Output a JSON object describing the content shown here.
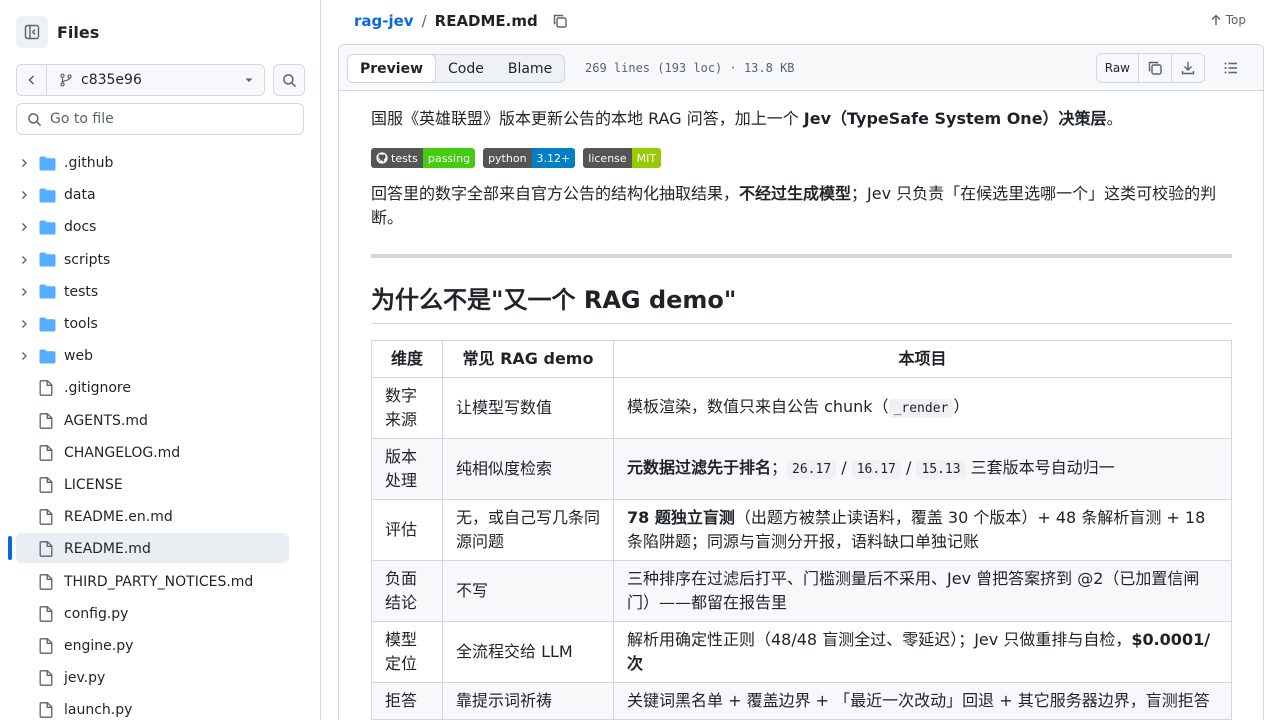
{
  "sidebar": {
    "title": "Files",
    "branch": "c835e96",
    "goto_placeholder": "Go to file",
    "items": [
      {
        "label": ".github",
        "type": "folder"
      },
      {
        "label": "data",
        "type": "folder"
      },
      {
        "label": "docs",
        "type": "folder"
      },
      {
        "label": "scripts",
        "type": "folder"
      },
      {
        "label": "tests",
        "type": "folder"
      },
      {
        "label": "tools",
        "type": "folder"
      },
      {
        "label": "web",
        "type": "folder"
      },
      {
        "label": ".gitignore",
        "type": "file"
      },
      {
        "label": "AGENTS.md",
        "type": "file"
      },
      {
        "label": "CHANGELOG.md",
        "type": "file"
      },
      {
        "label": "LICENSE",
        "type": "file"
      },
      {
        "label": "README.en.md",
        "type": "file"
      },
      {
        "label": "README.md",
        "type": "file",
        "active": true
      },
      {
        "label": "THIRD_PARTY_NOTICES.md",
        "type": "file"
      },
      {
        "label": "config.py",
        "type": "file"
      },
      {
        "label": "engine.py",
        "type": "file"
      },
      {
        "label": "jev.py",
        "type": "file"
      },
      {
        "label": "launch.py",
        "type": "file"
      }
    ]
  },
  "header": {
    "repo": "rag-jev",
    "separator": "/",
    "file": "README.md",
    "top_label": "Top"
  },
  "toolbar": {
    "tabs": [
      "Preview",
      "Code",
      "Blame"
    ],
    "meta": "269 lines (193 loc) · 13.8 KB",
    "raw_label": "Raw"
  },
  "readme": {
    "intro_plain": "国服《英雄联盟》版本更新公告的本地 RAG 问答，加上一个 ",
    "intro_bold": "Jev（TypeSafe System One）决策层",
    "intro_end": "。",
    "badges": [
      {
        "left": "tests",
        "right": "passing",
        "color": "#4c1"
      },
      {
        "left": "python",
        "right": "3.12+",
        "color": "#007ec6"
      },
      {
        "left": "license",
        "right": "MIT",
        "color": "#97ca00"
      }
    ],
    "p2_a": "回答里的数字全部来自官方公告的结构化抽取结果，",
    "p2_bold": "不经过生成模型",
    "p2_b": "；Jev 只负责「在候选里选哪一个」这类可校验的判断。",
    "h2": "为什么不是\"又一个 RAG demo\"",
    "table": {
      "headers": [
        "维度",
        "常见 RAG demo",
        "本项目"
      ],
      "rows": [
        {
          "c1": "数字来源",
          "c2": "让模型写数值",
          "c3_a": "模板渲染，数值只来自公告 chunk（",
          "c3_code": "_render",
          "c3_b": "）"
        },
        {
          "c1": "版本处理",
          "c2": "纯相似度检索",
          "c3_bold": "元数据过滤先于排名",
          "c3_a": "；",
          "codes": [
            "26.17",
            "16.17",
            "15.13"
          ],
          "c3_b": " 三套版本号自动归一"
        },
        {
          "c1": "评估",
          "c2": "无，或自己写几条同源问题",
          "c3_bold": "78 题独立盲测",
          "c3_a": "（出题方被禁止读语料，覆盖 30 个版本）+ 48 条解析盲测 + 18 条陷阱题；同源与盲测分开报，语料缺口单独记账"
        },
        {
          "c1": "负面结论",
          "c2": "不写",
          "c3_a": "三种排序在过滤后打平、门槛测量后不采用、Jev 曾把答案挤到 @2（已加置信闸门）——都留在报告里"
        },
        {
          "c1": "模型定位",
          "c2": "全流程交给 LLM",
          "c3_a": "解析用确定性正则（48/48 盲测全过、零延迟）；Jev 只做重排与自检，",
          "c3_bold": "$0.0001/次"
        },
        {
          "c1": "拒答",
          "c2": "靠提示词祈祷",
          "c3_a": "关键词黑名单 + 覆盖边界 + 「最近一次改动」回退 + 其它服务器边界，盲测拒答"
        }
      ]
    }
  }
}
